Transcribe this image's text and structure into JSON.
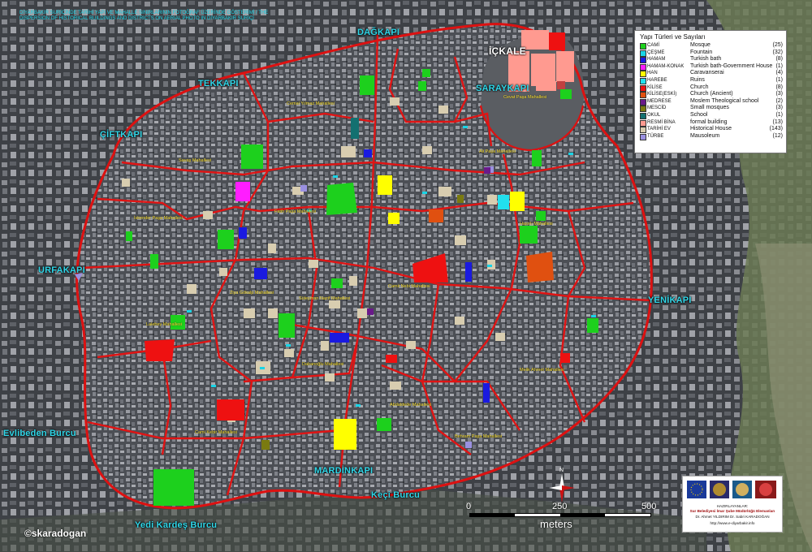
{
  "header_text": "DİYARBAKIR SURİÇİNDE TARİHİ YAPI VE MAHALLE SINIRLARININ FOTOĞRAF ÜZERİNDE GÖSTERİMİ / THE DISPERSION OF HISTORICAL BUILDINGS AND DISTRICTS ON AERIAL PHOTO IN DİYARBAKIR SURİÇİ",
  "gates": {
    "dagkapi": "DAĞKAPI",
    "ickale": "İÇKALE",
    "saraykapi": "SARAYKAPI",
    "tekkapi": "TEKKAPI",
    "ciftkapi": "ÇİFTKAPI",
    "urfakapi": "URFAKAPI",
    "yenikapi": "YENİKAPI",
    "evlibeden": "Evlibeden Burcu",
    "mardinkapi": "MARDİNKAPI",
    "keci": "Keçi Burcu",
    "yedi_kardes": "Yedi Kardeş Burcu"
  },
  "districts": [
    "Cemal Yılmaz Mahallesi",
    "Cevat Paşa Mahallesi",
    "Savaş Mahallesi",
    "Ali Paşa Mahallesi",
    "İskender Paşa Mahallesi",
    "Fatih Paşa Mahallesi",
    "Hasırlı Mahallesi",
    "Ziya Gökalp Mahallesi",
    "Süleyman Nazif Mahallesi",
    "Camii Nebi Mahallesi",
    "Lalebey Mahallesi",
    "Dabanoğlu Mahallesi",
    "Melik Ahmet Mahallesi",
    "Abdaldede Mahallesi",
    "Cami Kebir Mahallesi",
    "Behram Paşa Mahallesi"
  ],
  "legend": {
    "title": "Yapı Türleri ve Sayıları",
    "items": [
      {
        "code": "CAMİ",
        "desc": "Mosque",
        "count": "(25)",
        "color": "#1dd01d"
      },
      {
        "code": "ÇEŞME",
        "desc": "Fountain",
        "count": "(32)",
        "color": "#19d4e6"
      },
      {
        "code": "HAMAM",
        "desc": "Turkish bath",
        "count": "(8)",
        "color": "#1a1ae0"
      },
      {
        "code": "HAMAM-KONAK",
        "desc": "Turkish bath-Government House",
        "count": "(1)",
        "color": "#ff1dff"
      },
      {
        "code": "HAN",
        "desc": "Caravanserai",
        "count": "(4)",
        "color": "#ffff00"
      },
      {
        "code": "HAREBE",
        "desc": "Ruins",
        "count": "(1)",
        "color": "#22e0ee"
      },
      {
        "code": "KİLİSE",
        "desc": "Church",
        "count": "(8)",
        "color": "#ee1111"
      },
      {
        "code": "KİLİSE(ESKİ)",
        "desc": "Church (Ancient)",
        "count": "(3)",
        "color": "#e05010"
      },
      {
        "code": "MEDRESE",
        "desc": "Moslem Theological school",
        "count": "(2)",
        "color": "#6a1a8a"
      },
      {
        "code": "MESCİD",
        "desc": "Small mosques",
        "count": "(3)",
        "color": "#7a7a10"
      },
      {
        "code": "OKUL",
        "desc": "School",
        "count": "(1)",
        "color": "#137070"
      },
      {
        "code": "RESMİ BİNA",
        "desc": "formal building",
        "count": "(13)",
        "color": "#ff9a90"
      },
      {
        "code": "TARİHİ EV",
        "desc": "Historical House",
        "count": "(143)",
        "color": "#d8cdb0"
      },
      {
        "code": "TÜRBE",
        "desc": "Mausoleum",
        "count": "(12)",
        "color": "#9a90e0"
      }
    ]
  },
  "scale": {
    "ticks": [
      "0",
      "250",
      "500"
    ],
    "unit": "meters"
  },
  "credits": {
    "heading": "HAZIRLAYANLAR:",
    "org": "Sur Belediyesi İmar Şube Müdürlüğü Elemanları",
    "authors": "Dr. Ahmet YILDIRIM   Dr. Sabri KARADOĞAN",
    "url": "http://www.e-diyarbakir.info"
  },
  "copyright": "©skaradogan",
  "compass_label": "N",
  "colors": {
    "wall": "#dd1111",
    "streets": "#e01414",
    "gate_label": "#2fd6e8",
    "district_label": "#ffe63a"
  }
}
